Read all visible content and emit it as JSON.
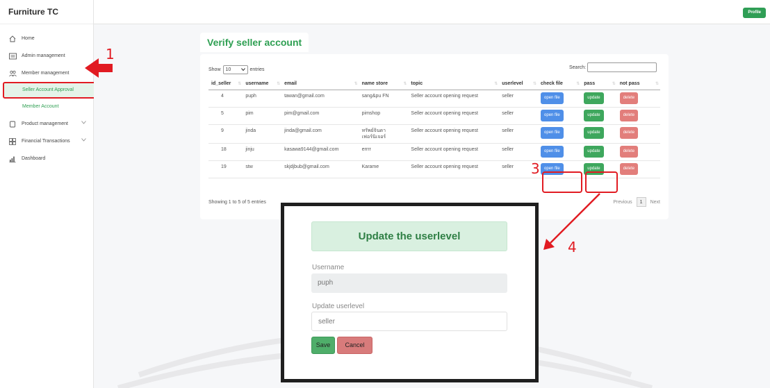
{
  "app": {
    "brand": "Furniture TC",
    "profile_label": "Profile"
  },
  "sidebar": {
    "items": [
      {
        "label": "Home",
        "icon": "home-icon"
      },
      {
        "label": "Admin management",
        "icon": "id-card-icon"
      },
      {
        "label": "Member management",
        "icon": "users-icon"
      },
      {
        "label": "Seller Account Approval",
        "active": true
      },
      {
        "label": "Member Account"
      },
      {
        "label": "Product management",
        "icon": "box-icon"
      },
      {
        "label": "Financial Transactions",
        "icon": "grid-icon"
      },
      {
        "label": "Dashboard",
        "icon": "bar-chart-icon"
      }
    ]
  },
  "page": {
    "title": "Verify seller account"
  },
  "table": {
    "show_label": "Show",
    "entries_value": "10",
    "entries_label": "entries",
    "search_label": "Search:",
    "columns": [
      "id_seller",
      "username",
      "email",
      "name store",
      "topic",
      "userlevel",
      "check file",
      "pass",
      "not pass"
    ],
    "rows": [
      {
        "id": "4",
        "username": "puph",
        "email": "tawan@gmail.com",
        "store": "sang&pu FN",
        "topic": "Seller account opening request",
        "level": "seller"
      },
      {
        "id": "5",
        "username": "pim",
        "email": "pim@gmail.com",
        "store": "pimshop",
        "topic": "Seller account opening request",
        "level": "seller"
      },
      {
        "id": "9",
        "username": "jinda",
        "email": "jinda@gmail.com",
        "store": "ทรัพย์จินดา เฟอร์นิเจอร์",
        "topic": "Seller account opening request",
        "level": "seller"
      },
      {
        "id": "18",
        "username": "jinju",
        "email": "kasawa9144@gmail.com",
        "store": "errrr",
        "topic": "Seller account opening request",
        "level": "seller"
      },
      {
        "id": "19",
        "username": "stw",
        "email": "skjdjbub@gmail.com",
        "store": "Karame",
        "topic": "Seller account opening request",
        "level": "seller"
      }
    ],
    "btn_open": "open file",
    "btn_update": "update",
    "btn_delete": "delete",
    "info": "Showing 1 to 5 of 5 entries",
    "prev": "Previous",
    "page": "1",
    "next": "Next"
  },
  "modal": {
    "title": "Update the userlevel",
    "username_label": "Username",
    "username_value": "puph",
    "level_label": "Update userlevel",
    "level_value": "seller",
    "save": "Save",
    "cancel": "Cancel"
  },
  "annotations": {
    "n1": "1",
    "n3": "3",
    "n4": "4"
  },
  "colors": {
    "accent": "#2e9f52",
    "annotation": "#e11b22",
    "blue": "#4f8fe8",
    "red": "#d9534f"
  }
}
